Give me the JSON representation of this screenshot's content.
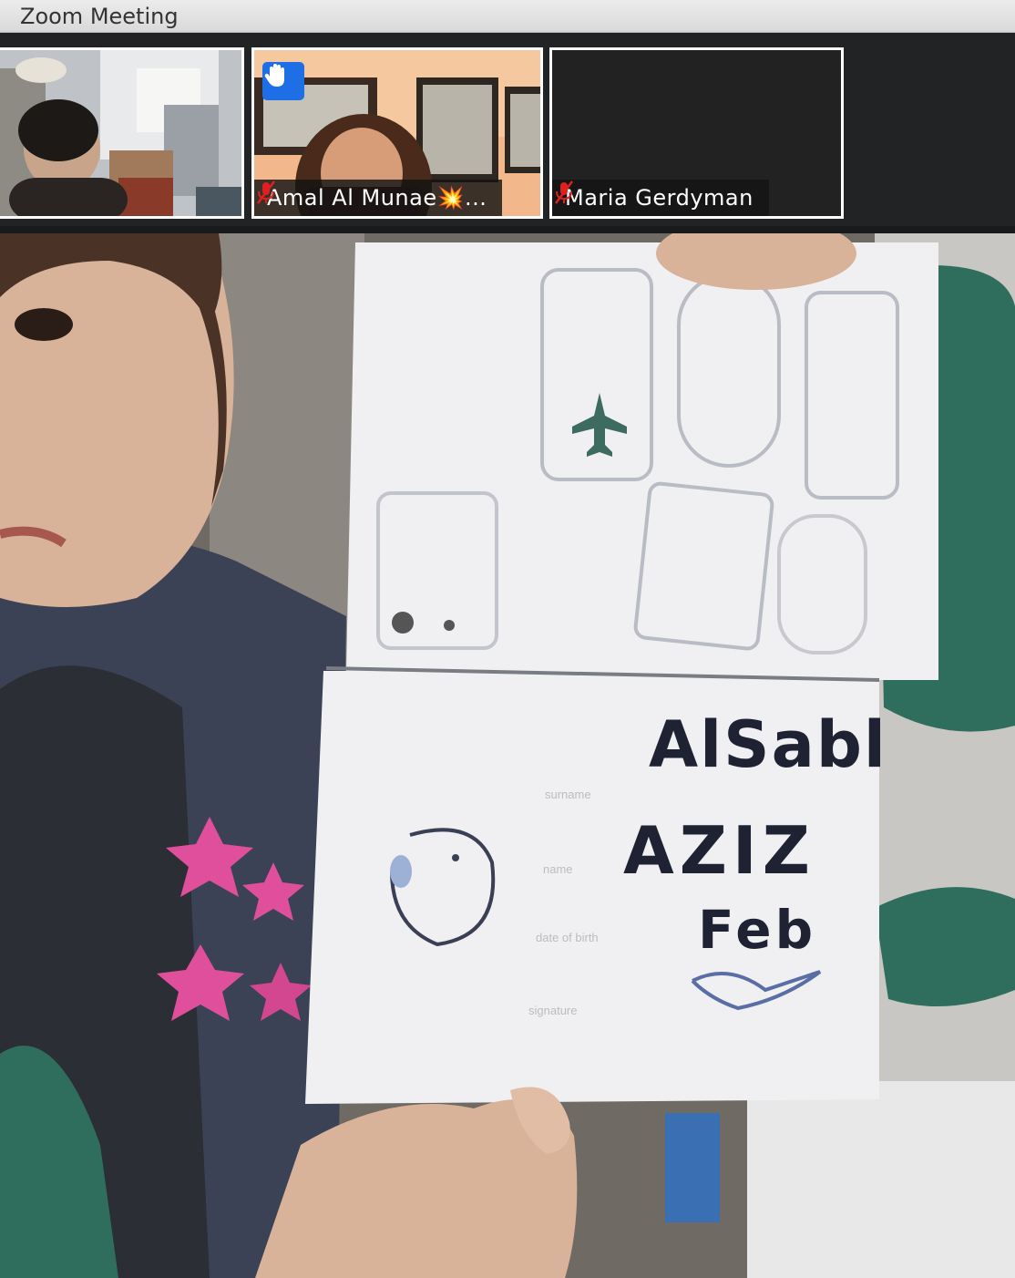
{
  "window": {
    "title": "Zoom Meeting"
  },
  "participants": [
    {
      "name": "",
      "muted": false,
      "hand_raised": false
    },
    {
      "name": "Amal Al Munae💥...",
      "muted": true,
      "hand_raised": true
    },
    {
      "name": "Maria Gerdyman",
      "muted": true,
      "hand_raised": false
    }
  ],
  "drawing": {
    "line1": "AlSabl",
    "line2": "AZIZ",
    "line3": "Feb",
    "label1": "surname",
    "label2": "name",
    "label3": "date of birth",
    "label4": "signature"
  },
  "colors": {
    "hand_badge": "#1e6fe6",
    "muted_icon": "#e02020",
    "active_border": "#ffffff"
  },
  "icons": [
    "raised-hand-icon",
    "muted-mic-icon"
  ]
}
